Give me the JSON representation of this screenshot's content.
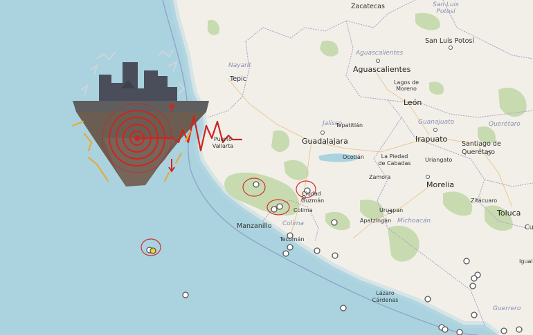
{
  "map": {
    "cities": {
      "zacatecas": "Zacatecas",
      "san_luis_potosi": "San Luis Potosí",
      "aguascalientes": "Aguascalientes",
      "tepic": "Tepic",
      "lagos_de_moreno": "Lagos de Moreno",
      "leon": "León",
      "tepatitlan": "Tepatitlán",
      "guadalajara": "Guadalajara",
      "irapuato": "Irapuato",
      "santiago_de_queretaro": "Santiago de Querétaro",
      "puerto_vallarta": "Puerto Vallarta",
      "ocotlan": "Ocotlán",
      "la_piedad": "La Piedad de Cabadas",
      "uriangato": "Uriangato",
      "zamora": "Zamora",
      "morelia": "Morelia",
      "ciudad_guzman": "Ciudad Guzmán",
      "colima": "Colima",
      "zitacuaro": "Zitácuaro",
      "toluca": "Toluca",
      "manzanillo": "Manzanillo",
      "uruapan": "Uruapan",
      "apatzingan": "Apatzingán",
      "tecoman": "Tecomán",
      "lazaro_cardenas": "Lázaro Cárdenas",
      "iguala": "Igual",
      "cu": "Cu"
    },
    "states": {
      "san_luis_potosi": "San Luis Potosí",
      "aguascalientes": "Aguascalientes",
      "nayarit": "Nayarit",
      "jalisco": "Jalisco",
      "guanajuato": "Guanajuato",
      "queretaro": "Querétaro",
      "colima": "Colima",
      "michoacan": "Michoacán",
      "guerrero": "Guerrero"
    },
    "colors": {
      "ocean": "#aad3df",
      "land": "#f2efe9",
      "forest": "#c8dbb0",
      "border": "#a9a4c4",
      "quake_circle": "#d32f2f",
      "marker_fill": "#ffffff",
      "marker_highlight": "#f5d323"
    },
    "illustration_icon": "earthquake-island-icon"
  }
}
